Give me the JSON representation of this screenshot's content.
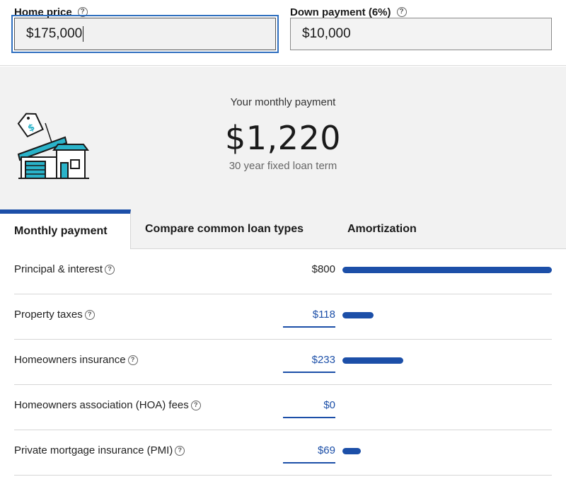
{
  "inputs": {
    "home_price": {
      "label": "Home price",
      "value": "$175,000"
    },
    "down_payment": {
      "label": "Down payment (6%)",
      "value": "$10,000"
    }
  },
  "help_glyph": "?",
  "summary": {
    "label": "Your monthly payment",
    "amount": "$1,220",
    "term": "30 year fixed loan term"
  },
  "tabs": [
    {
      "label": "Monthly payment",
      "active": true
    },
    {
      "label": "Compare common loan types",
      "active": false
    },
    {
      "label": "Amortization",
      "active": false
    }
  ],
  "breakdown": [
    {
      "label": "Principal & interest",
      "value": "$800",
      "editable": false,
      "fraction": 1.0
    },
    {
      "label": "Property taxes",
      "value": "$118",
      "editable": true,
      "fraction": 0.1475
    },
    {
      "label": "Homeowners insurance",
      "value": "$233",
      "editable": true,
      "fraction": 0.29125
    },
    {
      "label": "Homeowners association (HOA) fees",
      "value": "$0",
      "editable": true,
      "fraction": 0
    },
    {
      "label": "Private mortgage insurance (PMI)",
      "value": "$69",
      "editable": true,
      "fraction": 0.08625
    }
  ],
  "colors": {
    "accent": "#1c4fa8",
    "focus": "#2f6fbf",
    "summary_bg": "#f2f2f2",
    "house_teal": "#2ab3c9"
  }
}
